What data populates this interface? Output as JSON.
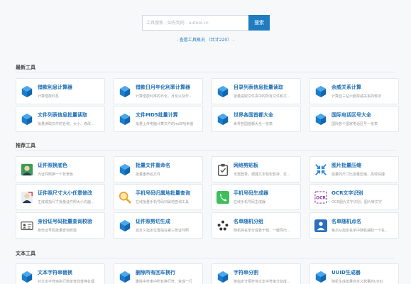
{
  "search": {
    "placeholder": "工具搜索 , 如先到网 - uutool.cn",
    "button": "搜索"
  },
  "view_all": "- 查看工具概况 （共计220） -",
  "sections": [
    {
      "title": "最新工具",
      "cards": [
        {
          "title": "借款利息计算器",
          "desc": "计算借款利息",
          "icon": "cube-icon"
        },
        {
          "title": "借款日月年化利率计算器",
          "desc": "计算借款利率的日化、月化以及年…",
          "icon": "cube-icon"
        },
        {
          "title": "目录列表信息批量读取",
          "desc": "批量提取文件夹中的所有文件和文…",
          "icon": "cube-icon"
        },
        {
          "title": "余威关系计算",
          "desc": "计算自三站六服常戚关系的称法",
          "icon": "cube-icon"
        },
        {
          "title": "文件列表信息批量读取",
          "desc": "批量读取文件的名称、大小、修改…",
          "icon": "cube-icon"
        },
        {
          "title": "文件MD5批量计算",
          "desc": "批量上传电脑计算文件的md5哈希值",
          "icon": "cube-icon"
        },
        {
          "title": "世界各国首都大全",
          "desc": "世界各国首都大全一览表",
          "icon": "cube-icon"
        },
        {
          "title": "国际电话区号大全",
          "desc": "国际各个国家电话区号一览表",
          "icon": "cube-icon"
        }
      ]
    },
    {
      "title": "推荐工具",
      "cards": [
        {
          "title": "证件照换底色",
          "desc": "为证件照换一个背景色",
          "icon": "id-photo-icon"
        },
        {
          "title": "批量文件重命名",
          "desc": "批量重命名文件",
          "icon": "cube-icon"
        },
        {
          "title": "网络剪贴板",
          "desc": "无需登录，便捷文本轻松暂存、支…",
          "icon": "clipboard-icon"
        },
        {
          "title": "图片批量压缩",
          "desc": "批量的尺寸比批量压缩、高效快捷",
          "icon": "compress-arrows-icon"
        },
        {
          "title": "证件照尺寸大小任意修改",
          "desc": "生成或指尺寸批量证件照大小充面…",
          "icon": "resize-photo-icon"
        },
        {
          "title": "手机号码归属地批量查询",
          "desc": "在线批量手机号码归属地查询工具",
          "icon": "magnifier-icon"
        },
        {
          "title": "手机号码生成器",
          "desc": "在线手机号码生成器",
          "icon": "phone-icon"
        },
        {
          "title": "OCR文字识别",
          "desc": "OCR图片文字识别，图片转文字",
          "icon": "ocr-icon"
        },
        {
          "title": "身份证号码批量查询校验",
          "desc": "身份证号码批量查询校验",
          "icon": "id-card-icon"
        },
        {
          "title": "证件照剪切生成",
          "desc": "自定义指定位置拍在第三张证件照",
          "icon": "cube-icon"
        },
        {
          "title": "名单随机分组",
          "desc": "随机将名单分成若干组，一键导出…",
          "icon": "group-icon"
        },
        {
          "title": "名单随机点名",
          "desc": "每次从指定名单中随机抽取一个名…",
          "icon": "roll-call-icon"
        }
      ]
    },
    {
      "title": "文本工具",
      "cards": [
        {
          "title": "文本字符串替换",
          "desc": "对文本字符串执行简单查找替换处理",
          "icon": "cube-icon"
        },
        {
          "title": "删除所有回车换行",
          "desc": "删除字符串中所有换行符、变成一行",
          "icon": "cube-icon"
        },
        {
          "title": "字符串分割",
          "desc": "按指定分隔符将文本字符串分割成…",
          "icon": "cube-icon"
        },
        {
          "title": "UUID生成器",
          "desc": "随机生成批量自定义数量的UUID",
          "icon": "cube-icon"
        }
      ]
    }
  ],
  "colors": {
    "accent": "#1f7cc0",
    "title_blue": "#1f6fb4",
    "cube_blue": "#1e88d6"
  }
}
